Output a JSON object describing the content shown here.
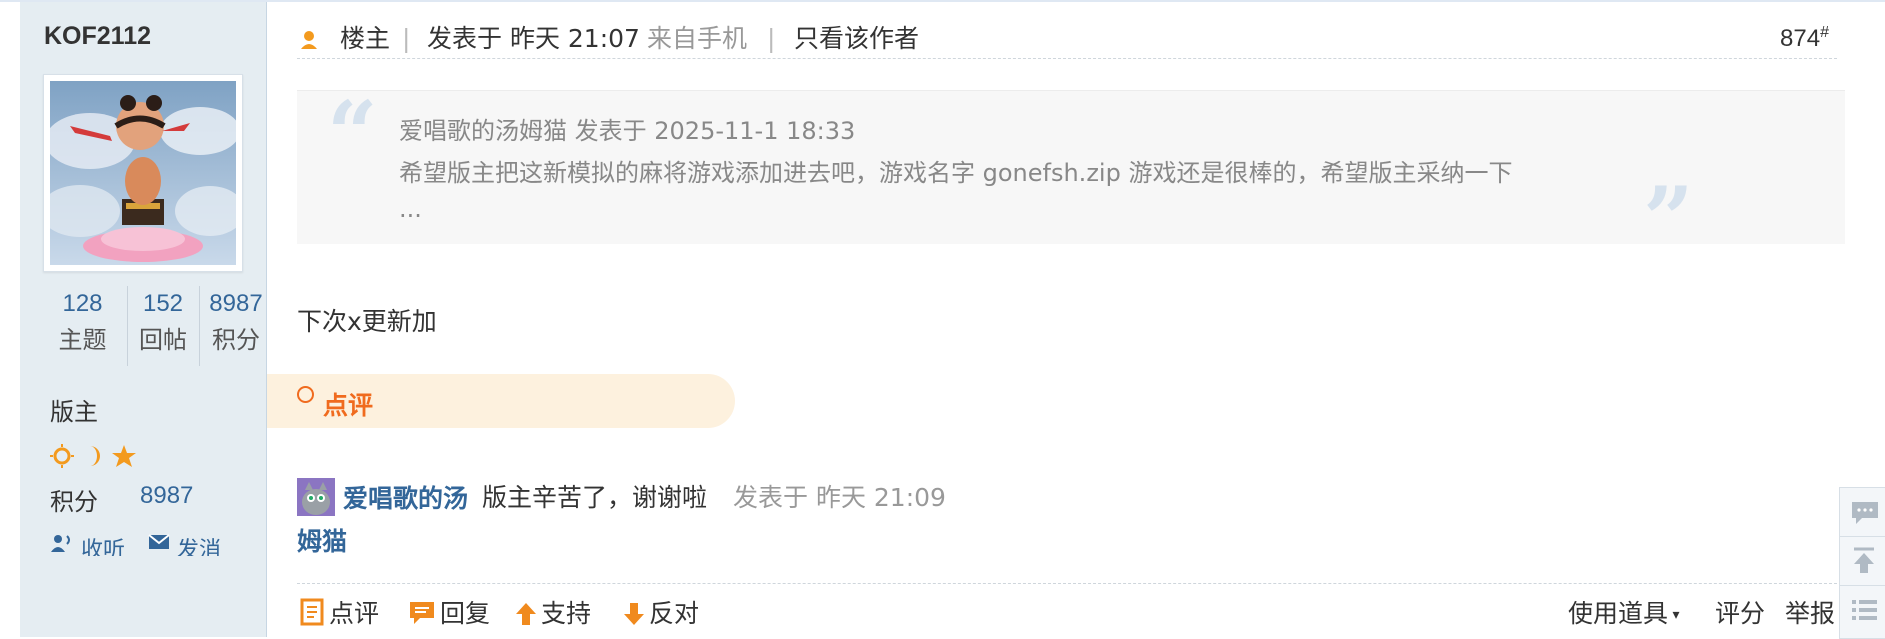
{
  "user": {
    "name": "KOF2112",
    "stats": [
      {
        "value": "128",
        "label": "主题"
      },
      {
        "value": "152",
        "label": "回帖"
      },
      {
        "value": "8987",
        "label": "积分"
      }
    ],
    "group": "版主",
    "points_label": "积分",
    "points_value": "8987",
    "actions": {
      "listen": "收听",
      "message": "发消"
    }
  },
  "post": {
    "op_label": "楼主",
    "posted_at": "发表于 昨天 21:07",
    "source": "来自手机",
    "author_only": "只看该作者",
    "floor": "874",
    "floor_mark": "#",
    "quote": {
      "author_line": "爱唱歌的汤姆猫 发表于 2025-11-1 18:33",
      "text": "希望版主把这新模拟的麻将游戏添加进去吧，游戏名字 gonefsh.zip 游戏还是很棒的，希望版主采纳一下",
      "more": "..."
    },
    "content": "下次x更新加"
  },
  "comments": {
    "title": "点评",
    "items": [
      {
        "user_line1": "爱唱歌的汤",
        "user_line2": "姆猫",
        "text": "版主辛苦了，谢谢啦",
        "time": "发表于 昨天 21:09"
      }
    ]
  },
  "bottom_bar": {
    "comment": "点评",
    "reply": "回复",
    "support": "支持",
    "oppose": "反对",
    "tools": "使用道具",
    "rate": "评分",
    "report": "举报"
  },
  "colors": {
    "link": "#336699",
    "accent": "#f06b1e",
    "sidebar_bg": "#e5edf2"
  }
}
